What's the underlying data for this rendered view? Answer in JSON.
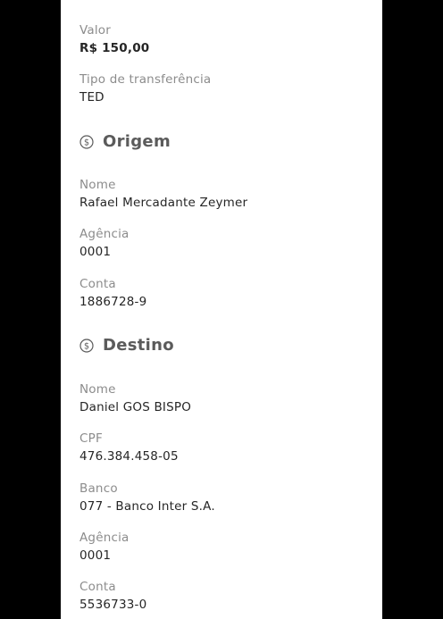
{
  "transfer": {
    "amount_label": "Valor",
    "amount_value": "R$ 150,00",
    "type_label": "Tipo de transferência",
    "type_value": "TED"
  },
  "origin": {
    "title": "Origem",
    "icon": "dollar-circle-icon",
    "name_label": "Nome",
    "name_value": "Rafael Mercadante Zeymer",
    "agency_label": "Agência",
    "agency_value": "0001",
    "account_label": "Conta",
    "account_value": "1886728-9"
  },
  "destination": {
    "title": "Destino",
    "icon": "dollar-circle-icon",
    "name_label": "Nome",
    "name_value": "Daniel GOS BISPO",
    "cpf_label": "CPF",
    "cpf_value": "476.384.458-05",
    "bank_label": "Banco",
    "bank_value": "077 - Banco Inter S.A.",
    "agency_label": "Agência",
    "agency_value": "0001",
    "account_label": "Conta",
    "account_value": "5536733-0"
  },
  "colors": {
    "background": "#000000",
    "panel": "#ffffff",
    "label": "#8c8c8c",
    "value": "#262626",
    "section_title": "#5b5b5b"
  }
}
